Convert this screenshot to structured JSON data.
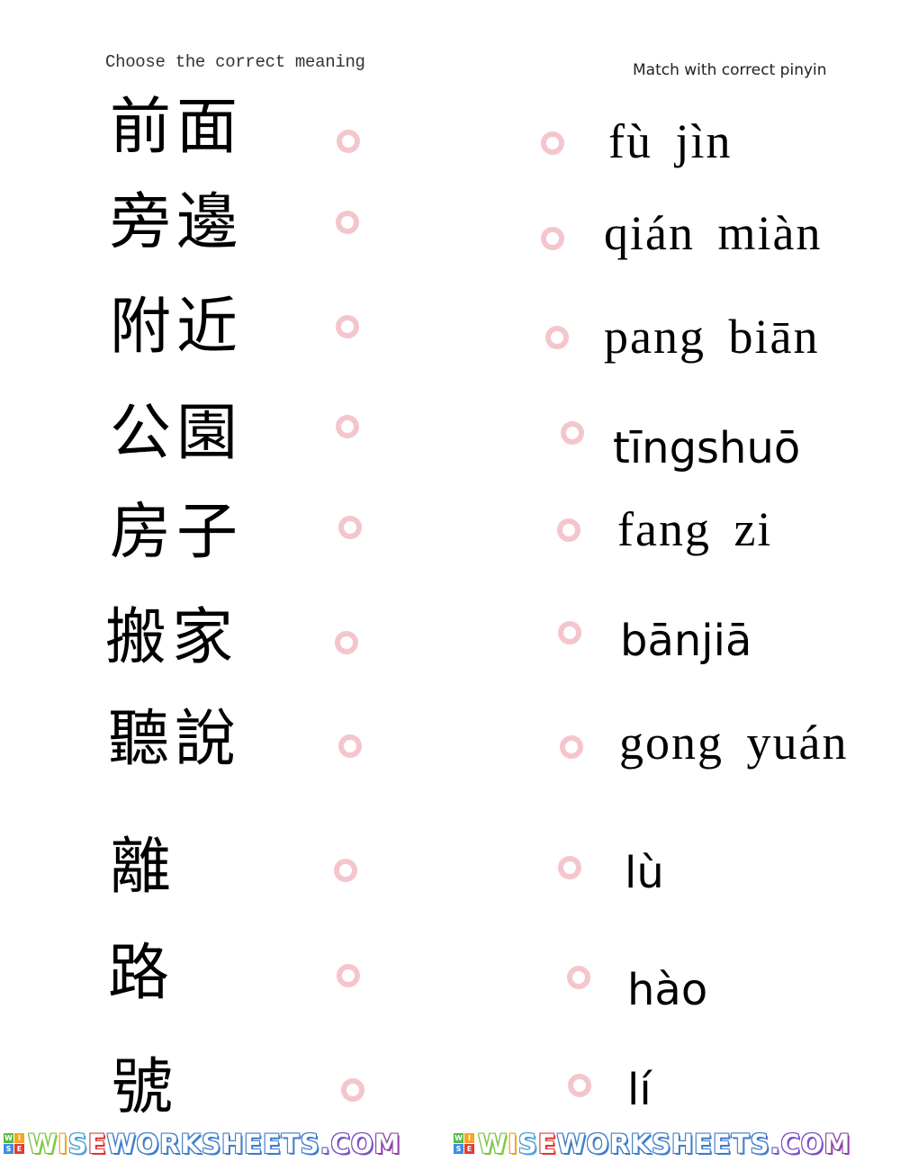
{
  "instructions": {
    "left": "Choose the correct meaning",
    "right": "Match with correct pinyin"
  },
  "colors": {
    "dot_ring": "#f4c6cc",
    "text": "#000000"
  },
  "hanzi_items": [
    {
      "text": "前面"
    },
    {
      "text": "旁邊"
    },
    {
      "text": "附近"
    },
    {
      "text": "公園"
    },
    {
      "text": "房子"
    },
    {
      "text": "搬家"
    },
    {
      "text": "聽說"
    },
    {
      "text": "離"
    },
    {
      "text": "路"
    },
    {
      "text": "號"
    }
  ],
  "pinyin_items": [
    {
      "text": "fù jìn"
    },
    {
      "text": "qián miàn"
    },
    {
      "text": "pang biān"
    },
    {
      "text": "tīngshuō"
    },
    {
      "text": "fang zi"
    },
    {
      "text": "bānjiā"
    },
    {
      "text": "gong yuán"
    },
    {
      "text": "lù"
    },
    {
      "text": "hào"
    },
    {
      "text": "lí"
    }
  ],
  "footer": {
    "logo_grid": [
      "W",
      "I",
      "S",
      "E"
    ],
    "logo_grid_colors": [
      "#5bb84a",
      "#f5a623",
      "#3a8ee6",
      "#e53935"
    ],
    "brand_text": "WISEWORKSHEETS.COM",
    "brand_letter_colors": [
      "#7ccd3c",
      "#f5a623",
      "#4aa3df",
      "#e53935",
      "#3f7fd0",
      "#3f7fd0",
      "#3f7fd0",
      "#3f7fd0",
      "#3f7fd0",
      "#3f7fd0",
      "#3f7fd0",
      "#3f7fd0",
      "#3f7fd0",
      "#3f7fd0",
      "#6a5acd",
      "#7b4fc9",
      "#7b4fc9",
      "#8e44ad"
    ]
  }
}
